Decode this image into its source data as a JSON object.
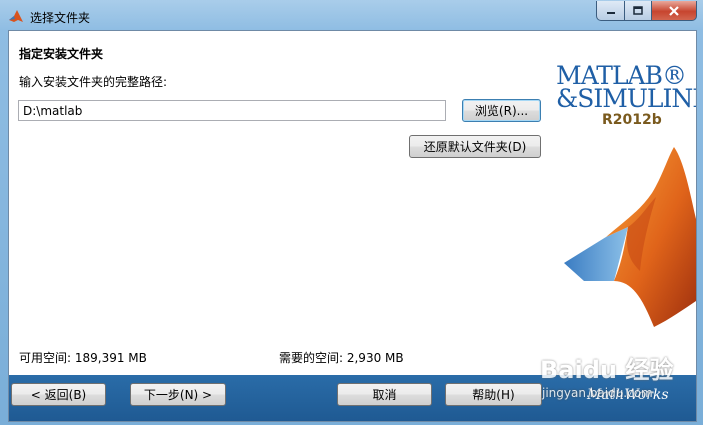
{
  "window": {
    "title": "选择文件夹",
    "icon": "matlab-icon",
    "caption_icons": [
      "minimize-icon",
      "maximize-icon",
      "close-icon"
    ]
  },
  "page": {
    "heading": "指定安装文件夹",
    "prompt": "输入安装文件夹的完整路径:",
    "path_value": "D:\\matlab",
    "browse_label": "浏览(R)...",
    "restore_label": "还原默认文件夹(D)"
  },
  "logo": {
    "line1": "MATLAB®",
    "line2": "&SIMULINK®",
    "release": "R2012b"
  },
  "space": {
    "free": "可用空间: 189,391 MB",
    "needed": "需要的空间: 2,930 MB"
  },
  "footer": {
    "back_label": "< 返回(B)",
    "next_label": "下一步(N) >",
    "cancel_label": "取消",
    "help_label": "帮助(H)",
    "brand": "MathWorks"
  },
  "watermark": {
    "text": "Baidu 经验",
    "url": "jingyan.baidu.com"
  },
  "colors": {
    "footer": "#1f5a93",
    "logo_blue": "#1f5fa6",
    "membrane_orange": "#e0641a"
  }
}
